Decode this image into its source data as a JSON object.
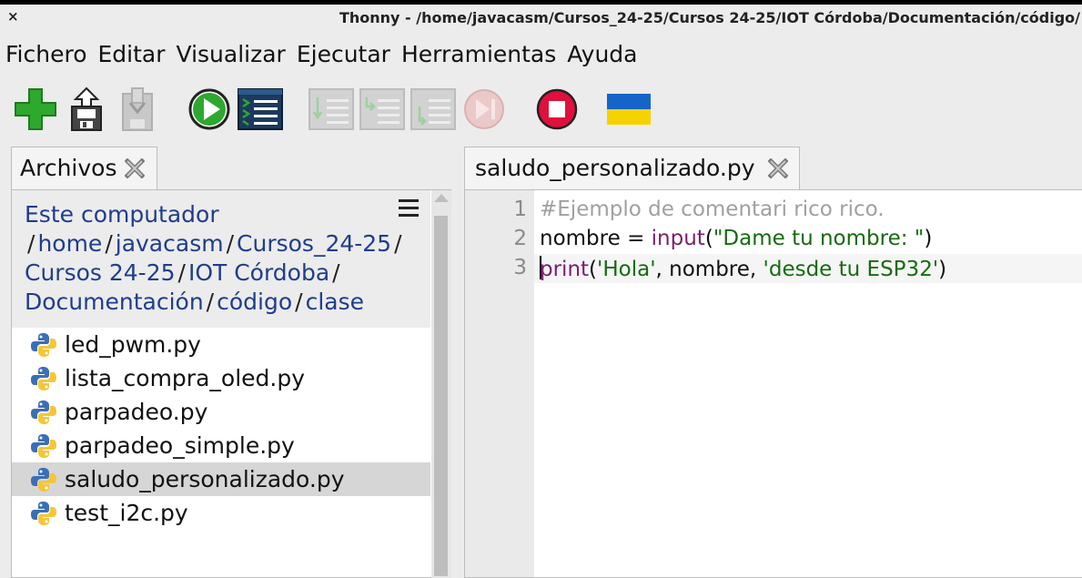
{
  "window": {
    "title": "Thonny  -  /home/javacasm/Cursos_24-25/Cursos 24-25/IOT Córdoba/Documentación/código/",
    "close_glyph": "×"
  },
  "menu": [
    "Fichero",
    "Editar",
    "Visualizar",
    "Ejecutar",
    "Herramientas",
    "Ayuda"
  ],
  "toolbar": {
    "buttons": [
      {
        "icon": "new-file-icon",
        "enabled": true
      },
      {
        "icon": "open-file-icon",
        "enabled": true
      },
      {
        "icon": "save-file-icon",
        "enabled": false
      },
      {
        "icon": "run-icon",
        "enabled": true
      },
      {
        "icon": "debug-icon",
        "enabled": true
      },
      {
        "icon": "step-over-icon",
        "enabled": false
      },
      {
        "icon": "step-into-icon",
        "enabled": false
      },
      {
        "icon": "step-out-icon",
        "enabled": false
      },
      {
        "icon": "resume-icon",
        "enabled": false
      },
      {
        "icon": "stop-icon",
        "enabled": true
      },
      {
        "icon": "ukraine-flag-icon",
        "enabled": true
      }
    ],
    "colors": {
      "green": "#2ea82e",
      "stop": "#e0103c",
      "disabled": "#c8c8c8",
      "flag_blue": "#1565c8",
      "flag_yellow": "#f5d300"
    }
  },
  "files": {
    "tab_label": "Archivos",
    "path_root": "Este computador",
    "path_segments": [
      [
        "home",
        "javacasm",
        "Cursos_24-25"
      ],
      [
        "Cursos 24-25",
        "IOT Córdoba"
      ],
      [
        "Documentación",
        "código",
        "clase"
      ]
    ],
    "path_separator": "/",
    "items": [
      {
        "name": "led_pwm.py",
        "selected": false
      },
      {
        "name": "lista_compra_oled.py",
        "selected": false
      },
      {
        "name": "parpadeo.py",
        "selected": false
      },
      {
        "name": "parpadeo_simple.py",
        "selected": false
      },
      {
        "name": "saludo_personalizado.py",
        "selected": true
      },
      {
        "name": "test_i2c.py",
        "selected": false
      }
    ]
  },
  "editor": {
    "tab_label": "saludo_personalizado.py",
    "lines": [
      {
        "n": "1",
        "tokens": [
          {
            "t": "#Ejemplo de comentari rico rico.",
            "k": "comment"
          }
        ]
      },
      {
        "n": "2",
        "tokens": [
          {
            "t": "nombre = ",
            "k": "plain"
          },
          {
            "t": "input",
            "k": "builtin"
          },
          {
            "t": "(",
            "k": "plain"
          },
          {
            "t": "\"Dame tu nombre: \"",
            "k": "string"
          },
          {
            "t": ")",
            "k": "plain"
          }
        ]
      },
      {
        "n": "3",
        "tokens": [
          {
            "t": "print",
            "k": "builtin"
          },
          {
            "t": "(",
            "k": "plain"
          },
          {
            "t": "'Hola'",
            "k": "string"
          },
          {
            "t": ", nombre, ",
            "k": "plain"
          },
          {
            "t": "'desde tu ESP32'",
            "k": "string"
          },
          {
            "t": ")",
            "k": "plain"
          }
        ]
      }
    ]
  }
}
